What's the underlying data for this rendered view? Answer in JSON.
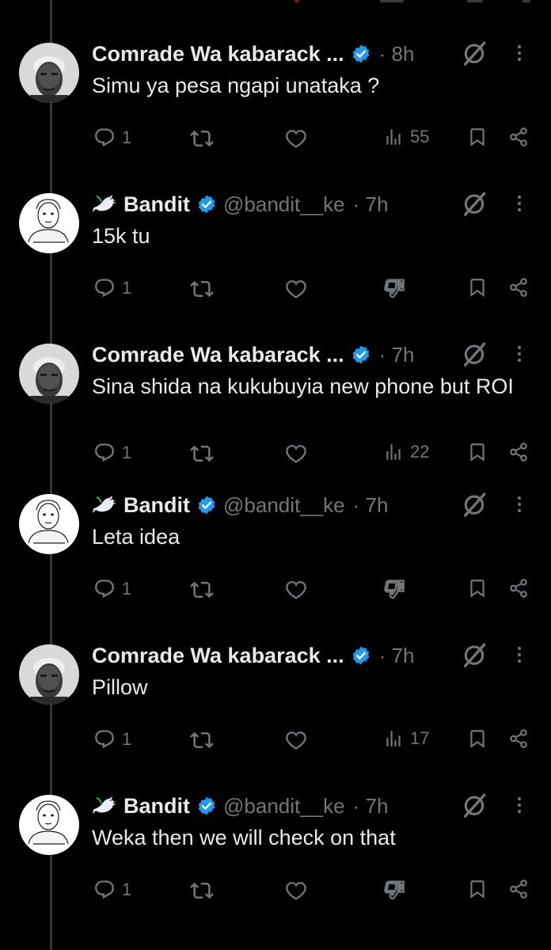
{
  "colors": {
    "background": "#000000",
    "text": "#e7e9ea",
    "muted": "#71767b",
    "verified": "#1d9bf0",
    "thread_line": "#333639"
  },
  "icons": {
    "reply": "reply-bubble-icon",
    "retweet": "retweet-icon",
    "like": "heart-icon",
    "views": "bar-chart-icon",
    "downvote": "thumbs-down-icon",
    "bookmark": "bookmark-icon",
    "share": "share-icon",
    "grok": "grok-slash-icon",
    "more": "vertical-ellipsis-icon",
    "verified": "verified-badge-icon",
    "dove": "dove-emoji"
  },
  "tweets": [
    {
      "author": "Comrade Wa kabarack ...",
      "handle": "",
      "time": "· 8h",
      "text": "Simu ya pesa ngapi unataka ?",
      "reply_count": "1",
      "views": "55",
      "has_views": true
    },
    {
      "author": "Bandit",
      "handle": "@bandit__ke",
      "time": "· 7h",
      "text": "15k tu",
      "reply_count": "1",
      "views": "",
      "has_views": false
    },
    {
      "author": "Comrade Wa kabarack ...",
      "handle": "",
      "time": "· 7h",
      "text": "Sina shida na kukubuyia new phone but ROI",
      "reply_count": "1",
      "views": "22",
      "has_views": true
    },
    {
      "author": "Bandit",
      "handle": "@bandit__ke",
      "time": "· 7h",
      "text": "Leta idea",
      "reply_count": "1",
      "views": "",
      "has_views": false
    },
    {
      "author": "Comrade Wa kabarack ...",
      "handle": "",
      "time": "· 7h",
      "text": "Pillow",
      "reply_count": "1",
      "views": "17",
      "has_views": true
    },
    {
      "author": "Bandit",
      "handle": "@bandit__ke",
      "time": "· 7h",
      "text": "Weka then we will check on that",
      "reply_count": "1",
      "views": "",
      "has_views": false
    }
  ]
}
